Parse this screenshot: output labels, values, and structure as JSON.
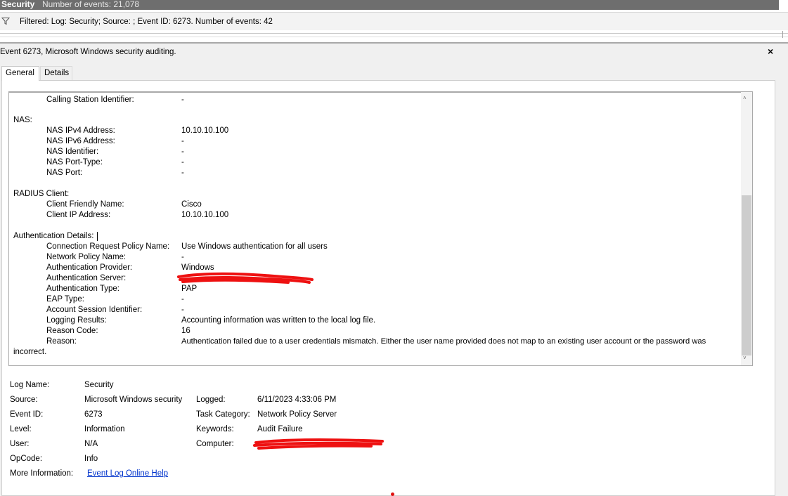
{
  "topbar": {
    "title": "Security",
    "count_text": "Number of events: 21,078"
  },
  "filter": {
    "icon": "funnel-icon",
    "text": "Filtered: Log: Security; Source: ; Event ID: 6273. Number of events: 42"
  },
  "detail": {
    "header": "Event 6273, Microsoft Windows security auditing.",
    "close_label": "×"
  },
  "tabs": [
    {
      "label": "General",
      "active": true
    },
    {
      "label": "Details",
      "active": false
    }
  ],
  "description": {
    "calling_station": {
      "key": "Calling Station Identifier:",
      "value": "-"
    },
    "nas": {
      "heading": "NAS:",
      "fields": [
        {
          "key": "NAS IPv4 Address:",
          "value": "10.10.10.100"
        },
        {
          "key": "NAS IPv6 Address:",
          "value": "-"
        },
        {
          "key": "NAS Identifier:",
          "value": "-"
        },
        {
          "key": "NAS Port-Type:",
          "value": "-"
        },
        {
          "key": "NAS Port:",
          "value": "-"
        }
      ]
    },
    "radius": {
      "heading": "RADIUS Client:",
      "fields": [
        {
          "key": "Client Friendly Name:",
          "value": "Cisco"
        },
        {
          "key": "Client IP Address:",
          "value": "10.10.10.100"
        }
      ]
    },
    "auth": {
      "heading": "Authentication Details:",
      "fields": [
        {
          "key": "Connection Request Policy Name:",
          "value": "Use Windows authentication for all users"
        },
        {
          "key": "Network Policy Name:",
          "value": "-"
        },
        {
          "key": "Authentication Provider:",
          "value": "Windows"
        },
        {
          "key": "Authentication Server:",
          "value": ""
        },
        {
          "key": "Authentication Type:",
          "value": "PAP"
        },
        {
          "key": "EAP Type:",
          "value": "-"
        },
        {
          "key": "Account Session Identifier:",
          "value": "-"
        },
        {
          "key": "Logging Results:",
          "value": "Accounting information was written to the local log file."
        },
        {
          "key": "Reason Code:",
          "value": "16"
        },
        {
          "key": "Reason:",
          "value": "Authentication failed due to a user credentials mismatch. Either the user name provided does not map to an existing user account or the password was"
        }
      ],
      "reason_wrap": "incorrect."
    }
  },
  "meta": {
    "log_name": {
      "label": "Log Name:",
      "value": "Security"
    },
    "source": {
      "label": "Source:",
      "value": "Microsoft Windows security a"
    },
    "logged": {
      "label": "Logged:",
      "value": "6/11/2023 4:33:06 PM"
    },
    "event_id": {
      "label": "Event ID:",
      "value": "6273"
    },
    "task_category": {
      "label": "Task Category:",
      "value": "Network Policy Server"
    },
    "level": {
      "label": "Level:",
      "value": "Information"
    },
    "keywords": {
      "label": "Keywords:",
      "value": "Audit Failure"
    },
    "user": {
      "label": "User:",
      "value": "N/A"
    },
    "computer": {
      "label": "Computer:",
      "value": ""
    },
    "opcode": {
      "label": "OpCode:",
      "value": "Info"
    },
    "more_info": {
      "label": "More Information:",
      "link": "Event Log Online Help"
    }
  },
  "colors": {
    "redaction": "#ee1111",
    "link": "#0033cc",
    "topbar": "#6e6e6e"
  }
}
